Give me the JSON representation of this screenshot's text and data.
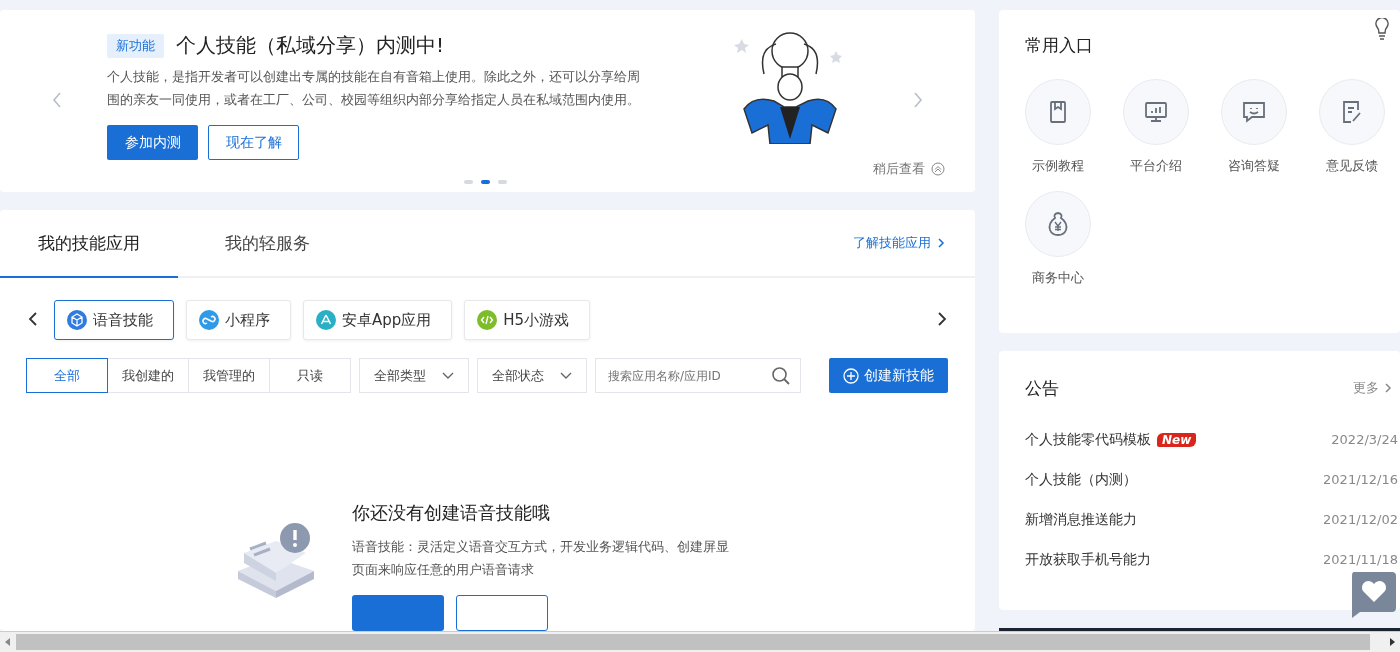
{
  "banner": {
    "badge": "新功能",
    "title": "个人技能（私域分享）内测中!",
    "description": "个人技能，是指开发者可以创建出专属的技能在自有音箱上使用。除此之外，还可以分享给周围的亲友一同使用，或者在工厂、公司、校园等组织内部分享给指定人员在私域范围内使用。",
    "buttons": [
      {
        "label": "参加内测",
        "kind": "primary"
      },
      {
        "label": "现在了解",
        "kind": "outline"
      }
    ],
    "later": "稍后查看",
    "dots": [
      {
        "selected": false
      },
      {
        "selected": true
      },
      {
        "selected": false
      }
    ]
  },
  "tabs": [
    {
      "label": "我的技能应用",
      "selected": true
    },
    {
      "label": "我的轻服务",
      "selected": false
    }
  ],
  "learn_link": "了解技能应用",
  "categories": [
    {
      "label": "语音技能",
      "selected": true,
      "kind": "cube",
      "color": "#2f7be0"
    },
    {
      "label": "小程序",
      "selected": false,
      "kind": "link",
      "color": "#2f9be8"
    },
    {
      "label": "安卓App应用",
      "selected": false,
      "kind": "app",
      "color": "#2ab0c6"
    },
    {
      "label": "H5小游戏",
      "selected": false,
      "kind": "code",
      "color": "#7dbd2a"
    }
  ],
  "filters": [
    {
      "label": "全部",
      "selected": true
    },
    {
      "label": "我创建的",
      "selected": false
    },
    {
      "label": "我管理的",
      "selected": false
    },
    {
      "label": "只读",
      "selected": false
    }
  ],
  "dropdowns": [
    "全部类型",
    "全部状态"
  ],
  "search": {
    "placeholder": "搜索应用名称/应用ID"
  },
  "create_button": "创建新技能",
  "empty_state": {
    "title": "你还没有创建语音技能哦",
    "description": "语音技能：灵活定义语音交互方式，开发业务逻辑代码、创建屏显页面来响应任意的用户语音请求"
  },
  "quick_entry": {
    "title": "常用入口",
    "items": [
      {
        "label": "示例教程",
        "kind": "book"
      },
      {
        "label": "平台介绍",
        "kind": "screen"
      },
      {
        "label": "咨询答疑",
        "kind": "chat"
      },
      {
        "label": "意见反馈",
        "kind": "edit"
      },
      {
        "label": "商务中心",
        "kind": "money"
      }
    ]
  },
  "notices": {
    "title": "公告",
    "more": "更多",
    "items": [
      {
        "title": "个人技能零代码模板",
        "badge": "New",
        "date": "2022/3/24"
      },
      {
        "title": "个人技能（内测）",
        "date": "2021/12/16"
      },
      {
        "title": "新增消息推送能力",
        "date": "2021/12/02"
      },
      {
        "title": "开放获取手机号能力",
        "date": "2021/11/18"
      }
    ]
  }
}
